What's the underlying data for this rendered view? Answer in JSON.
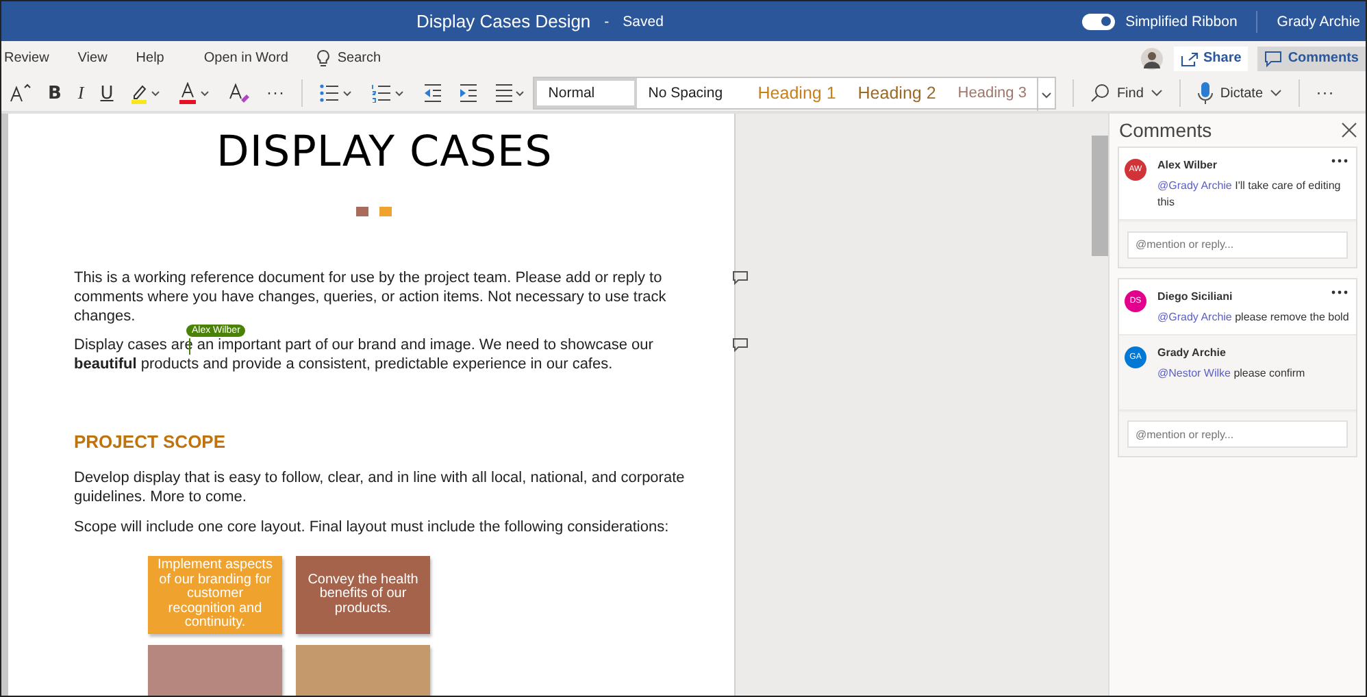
{
  "title_bar": {
    "title": "Display Cases Design",
    "separator": "-",
    "status": "Saved",
    "toggle": {
      "label": "Simplified Ribbon",
      "on": true
    },
    "user": "Grady Archie"
  },
  "menu": [
    {
      "label": "Review",
      "kind": "text"
    },
    {
      "label": "View",
      "kind": "text"
    },
    {
      "label": "Help",
      "kind": "text"
    },
    {
      "label": "Open in Word",
      "kind": "text"
    },
    {
      "label": "Search",
      "kind": "search"
    }
  ],
  "share": {
    "label": "Share"
  },
  "comments_button": {
    "label": "Comments",
    "selected": true
  },
  "toolbar": {
    "bold": "B",
    "italic": "I",
    "underline": "U",
    "more": "···",
    "styles": [
      {
        "label": "Normal",
        "kind": "normal",
        "selected": true
      },
      {
        "label": "No Spacing",
        "kind": "normal",
        "selected": false
      },
      {
        "label": "Heading 1",
        "kind": "heading1",
        "selected": false
      },
      {
        "label": "Heading 2",
        "kind": "heading2",
        "selected": false
      },
      {
        "label": "Heading 3",
        "kind": "heading3",
        "selected": false
      }
    ],
    "find": "Find",
    "dictate": "Dictate",
    "overflow": "···"
  },
  "document": {
    "title": "DISPLAY CASES",
    "paragraphs": [
      {
        "text": "This is a working reference document for use by the project team. Please add or reply to comments where you have changes, queries, or action items. Not necessary to use track changes.",
        "has_comment": true
      },
      {
        "text": "Display cases are an important part of our brand and image. We need to showcase our **beautiful** products and provide a consistent, predictable experience in our cafes.",
        "has_comment": true,
        "cursor": "Alex Wilber"
      }
    ],
    "heading": "PROJECT SCOPE",
    "body": [
      "Develop display that is easy to follow, clear, and in line with all local, national, and corporate guidelines. More to come.",
      "Scope will include one core layout. Final layout must include the following considerations:"
    ],
    "boxes": [
      {
        "text": "Implement aspects of our branding for customer recognition and continuity.",
        "color": "#f0a22e"
      },
      {
        "text": "Convey the health benefits of our products.",
        "color": "#a5634b"
      },
      {
        "color": "#b5877e"
      },
      {
        "color": "#c49a6c"
      }
    ]
  },
  "comments_pane": {
    "title": "Comments",
    "threads": [
      {
        "comments": [
          {
            "initials": "AW",
            "color": "#d13438",
            "author": "Alex Wilber",
            "mention": "@Grady Archie",
            "text": "I'll take care of editing this",
            "reply": false
          }
        ],
        "placeholder": "@mention or reply..."
      },
      {
        "comments": [
          {
            "initials": "DS",
            "color": "#e3008c",
            "author": "Diego Siciliani",
            "mention": "@Grady Archie",
            "text": "please remove the bold",
            "reply": false
          },
          {
            "initials": "GA",
            "color": "#0078d4",
            "author": "Grady Archie",
            "mention": "@Nestor Wilke",
            "text": "please confirm",
            "reply": true
          }
        ],
        "placeholder": "@mention or reply..."
      }
    ]
  }
}
